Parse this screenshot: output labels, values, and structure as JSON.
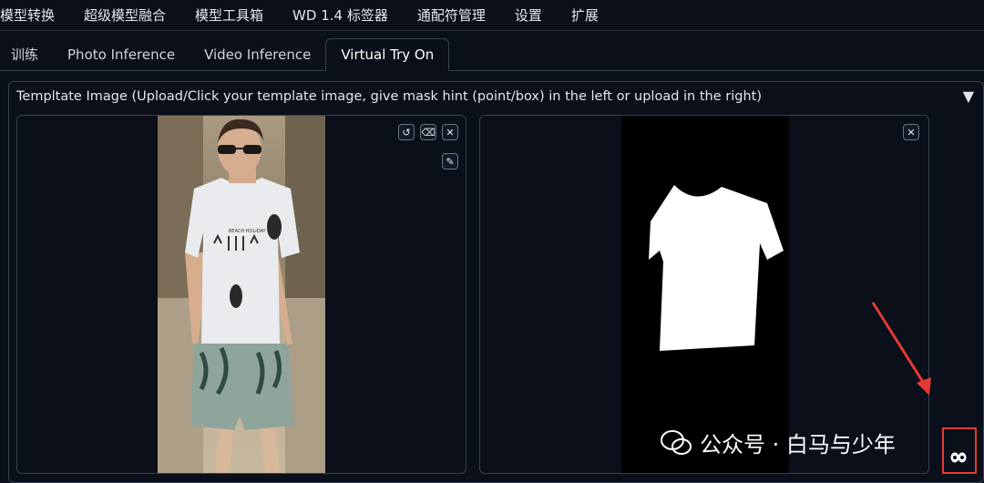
{
  "topnav": [
    "模型转换",
    "超级模型融合",
    "模型工具箱",
    "WD 1.4 标签器",
    "通配符管理",
    "设置",
    "扩展"
  ],
  "tabs": [
    "训练",
    "Photo Inference",
    "Video Inference",
    "Virtual Try On"
  ],
  "active_tab": "Virtual Try On",
  "accordion": {
    "title": "Templtate Image (Upload/Click your template image, give mask hint (point/box) in the left or upload in the right)",
    "arrow": "▼"
  },
  "left_panel": {
    "controls": [
      "undo-icon",
      "eraser-icon",
      "close-icon",
      "brush-icon"
    ],
    "shirt_text": "BEACH HOLIDAY"
  },
  "right_panel": {
    "controls": [
      "close-icon"
    ]
  },
  "watermark": {
    "text": "公众号 · 白马与少年"
  },
  "colors": {
    "background": "#0b0f19",
    "border": "#374151",
    "annotation": "#e53935"
  }
}
